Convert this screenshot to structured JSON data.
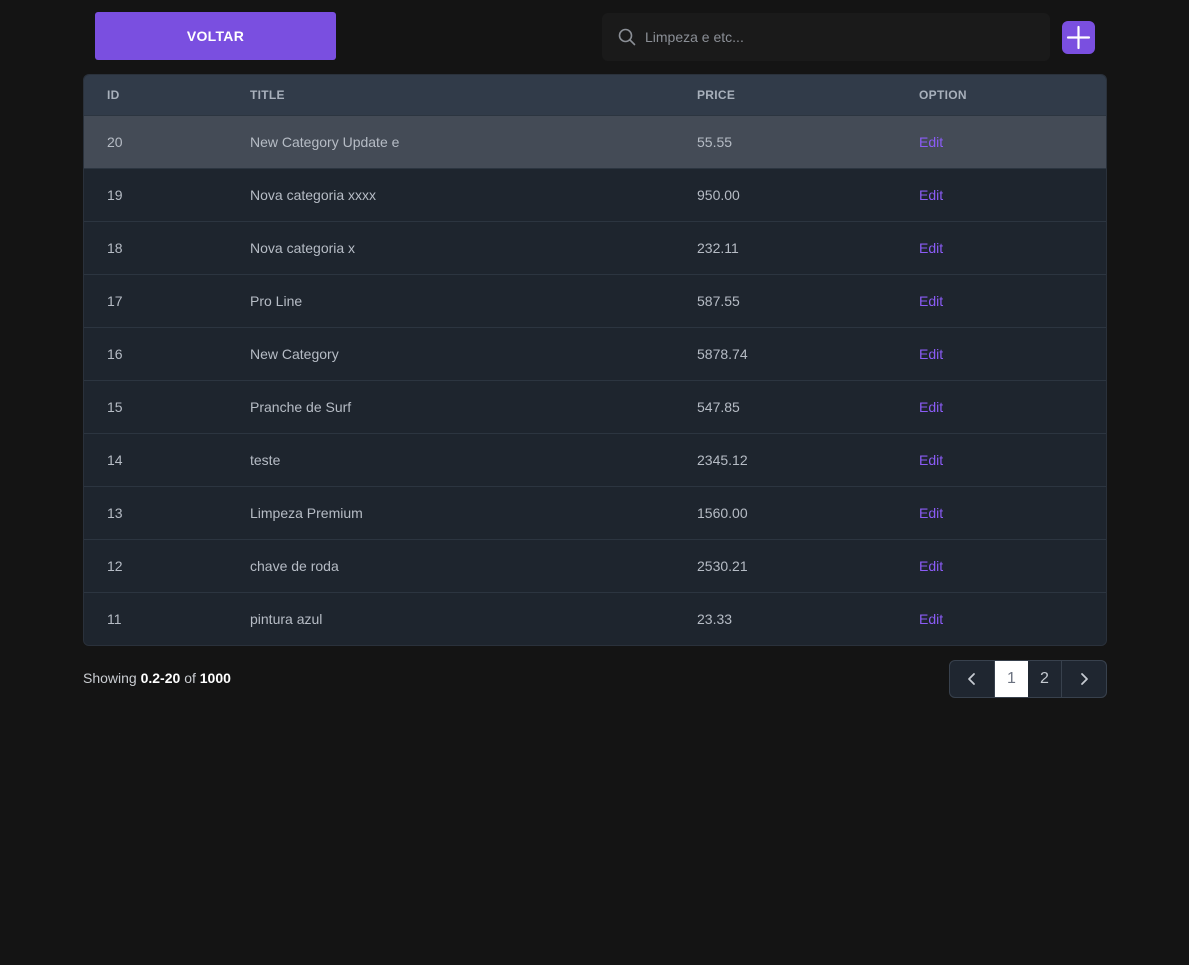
{
  "toolbar": {
    "back_label": "VOLTAR",
    "search_placeholder": "Limpeza e etc...",
    "search_value": ""
  },
  "table": {
    "headers": [
      "ID",
      "TITLE",
      "PRICE",
      "OPTION"
    ],
    "rows": [
      {
        "id": "20",
        "title": "New Category Update e",
        "price": "55.55",
        "option": "Edit"
      },
      {
        "id": "19",
        "title": "Nova categoria xxxx",
        "price": "950.00",
        "option": "Edit"
      },
      {
        "id": "18",
        "title": "Nova categoria x",
        "price": "232.11",
        "option": "Edit"
      },
      {
        "id": "17",
        "title": "Pro Line",
        "price": "587.55",
        "option": "Edit"
      },
      {
        "id": "16",
        "title": "New Category",
        "price": "5878.74",
        "option": "Edit"
      },
      {
        "id": "15",
        "title": "Pranche de Surf",
        "price": "547.85",
        "option": "Edit"
      },
      {
        "id": "14",
        "title": "teste",
        "price": "2345.12",
        "option": "Edit"
      },
      {
        "id": "13",
        "title": "Limpeza Premium",
        "price": "1560.00",
        "option": "Edit"
      },
      {
        "id": "12",
        "title": "chave de roda",
        "price": "2530.21",
        "option": "Edit"
      },
      {
        "id": "11",
        "title": "pintura azul",
        "price": "23.33",
        "option": "Edit"
      }
    ]
  },
  "footer": {
    "showing_label": "Showing",
    "range": "0.2-20",
    "of_label": "of",
    "total": "1000"
  },
  "pagination": {
    "pages": [
      "1",
      "2"
    ],
    "current": "1"
  },
  "colors": {
    "accent": "#7a4fe0",
    "link": "#8b5cf6",
    "background": "#141414"
  }
}
